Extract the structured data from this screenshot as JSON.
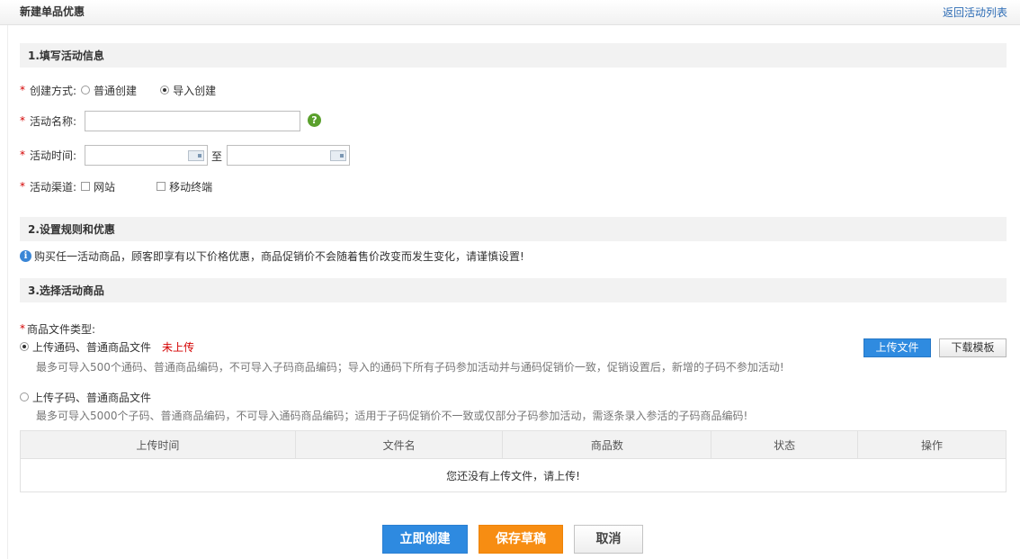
{
  "header": {
    "title": "新建单品优惠",
    "back_link": "返回活动列表"
  },
  "section1": {
    "title": "1.填写活动信息",
    "create_mode": {
      "label": "创建方式:",
      "options": [
        "普通创建",
        "导入创建"
      ],
      "selected": "导入创建"
    },
    "name": {
      "label": "活动名称:",
      "value": "",
      "help_icon": "question-circle-icon"
    },
    "time": {
      "label": "活动时间:",
      "start": "",
      "end": "",
      "separator": "至"
    },
    "channel": {
      "label": "活动渠道:",
      "options": [
        "网站",
        "移动终端"
      ]
    }
  },
  "section2": {
    "title": "2.设置规则和优惠",
    "notice": "购买任一活动商品，顾客即享有以下价格优惠，商品促销价不会随着售价改变而发生变化，请谨慎设置!"
  },
  "section3": {
    "title": "3.选择活动商品",
    "file_type_label": "商品文件类型:",
    "option_general": {
      "label": "上传通码、普通商品文件",
      "status": "未上传",
      "hint": "最多可导入500个通码、普通商品编码，不可导入子码商品编码；导入的通码下所有子码参加活动并与通码促销价一致，促销设置后，新增的子码不参加活动!"
    },
    "option_child": {
      "label": "上传子码、普通商品文件",
      "hint": "最多可导入5000个子码、普通商品编码，不可导入通码商品编码；适用于子码促销价不一致或仅部分子码参加活动，需逐条录入参活的子码商品编码!"
    },
    "upload_button": "上传文件",
    "download_button": "下载模板",
    "table": {
      "columns": [
        "上传时间",
        "文件名",
        "商品数",
        "状态",
        "操作"
      ],
      "empty_text": "您还没有上传文件，请上传!"
    }
  },
  "actions": {
    "create": "立即创建",
    "draft": "保存草稿",
    "cancel": "取消"
  },
  "colors": {
    "primary_blue": "#2e8ae0",
    "orange": "#f78d12",
    "required_red": "#d40000",
    "help_green": "#5aa02c"
  }
}
